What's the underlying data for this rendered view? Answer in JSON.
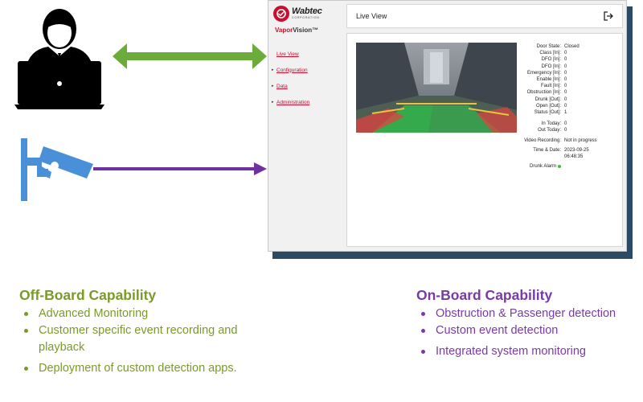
{
  "app": {
    "brand_name": "Wabtec",
    "brand_sub": "CORPORATION",
    "product_prefix": "Vapor",
    "product_suffix": "Vision™",
    "nav": [
      {
        "label": "Live View",
        "caret": false
      },
      {
        "label": "Configuration",
        "caret": true
      },
      {
        "label": "Data",
        "caret": true
      },
      {
        "label": "Administration",
        "caret": true
      }
    ],
    "header_title": "Live View",
    "status": [
      {
        "label": "Door State:",
        "value": "Closed"
      },
      {
        "label": "Class [In]:",
        "value": "0"
      },
      {
        "label": "DFO [In]:",
        "value": "0"
      },
      {
        "label": "DFO [In]:",
        "value": "0"
      },
      {
        "label": "Emergency [In]:",
        "value": "0"
      },
      {
        "label": "Enable [In]:",
        "value": "0"
      },
      {
        "label": "Fault [In]:",
        "value": "0"
      },
      {
        "label": "Obstruction [In]:",
        "value": "0"
      },
      {
        "label": "Drunk [Out]:",
        "value": "0"
      },
      {
        "label": "Open [Out]:",
        "value": "0"
      },
      {
        "label": "Status [Out]:",
        "value": "1"
      }
    ],
    "counts": [
      {
        "label": "In Today:",
        "value": "0"
      },
      {
        "label": "Out Today:",
        "value": "0"
      }
    ],
    "video_recording_label": "Video Recording:",
    "video_recording_value": "Not in progress",
    "time_date_label": "Time & Date:",
    "date_value": "2023-09-25",
    "time_value": "06:48:35",
    "drunk_alarm_label": "Drunk Alarm",
    "drunk_alarm_color": "#3cc23c"
  },
  "offboard": {
    "title": "Off-Board Capability",
    "color": "#7a9a2a",
    "items": [
      "Advanced Monitoring",
      "Customer specific event recording and",
      "playback",
      "Deployment of custom detection apps."
    ]
  },
  "onboard": {
    "title": "On-Board Capability",
    "color": "#7a3aa6",
    "items": [
      "Obstruction & Passenger detection",
      "Custom event detection",
      "Integrated system monitoring"
    ]
  },
  "icons": {
    "person": "person-at-laptop-icon",
    "camera": "security-camera-icon",
    "logout": "logout-icon"
  },
  "colors": {
    "green_arrow": "#6aab3a",
    "purple_arrow": "#7030a0",
    "camera": "#4a90d9",
    "app_shadow": "#2a4a66",
    "link": "#c8102e"
  }
}
